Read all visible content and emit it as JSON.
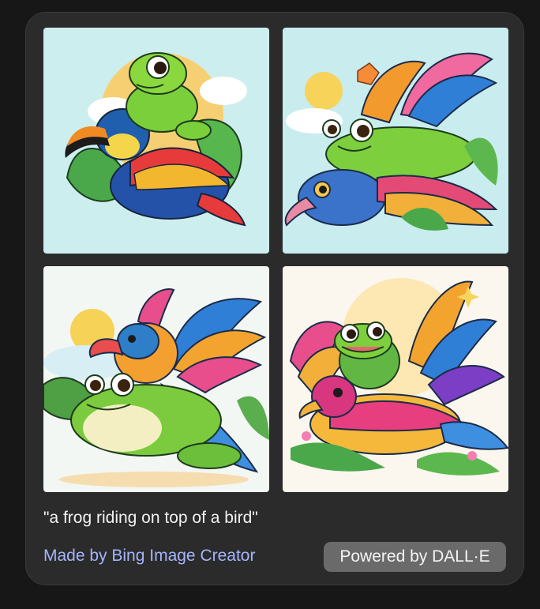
{
  "images": [
    {
      "name": "generated-image-1",
      "background": "#cdeeee"
    },
    {
      "name": "generated-image-2",
      "background": "#c9ecef"
    },
    {
      "name": "generated-image-3",
      "background": "#f3f7f3"
    },
    {
      "name": "generated-image-4",
      "background": "#fbf7ee"
    }
  ],
  "prompt": "\"a frog riding on top of a bird\"",
  "credit_link": "Made by Bing Image Creator",
  "powered_badge": "Powered by DALL·E",
  "colors": {
    "page_bg": "#171717",
    "card_bg": "#2b2b2b",
    "link": "#a5b4fc",
    "badge_bg": "#6a6a6a",
    "text": "#f2f2f2"
  }
}
